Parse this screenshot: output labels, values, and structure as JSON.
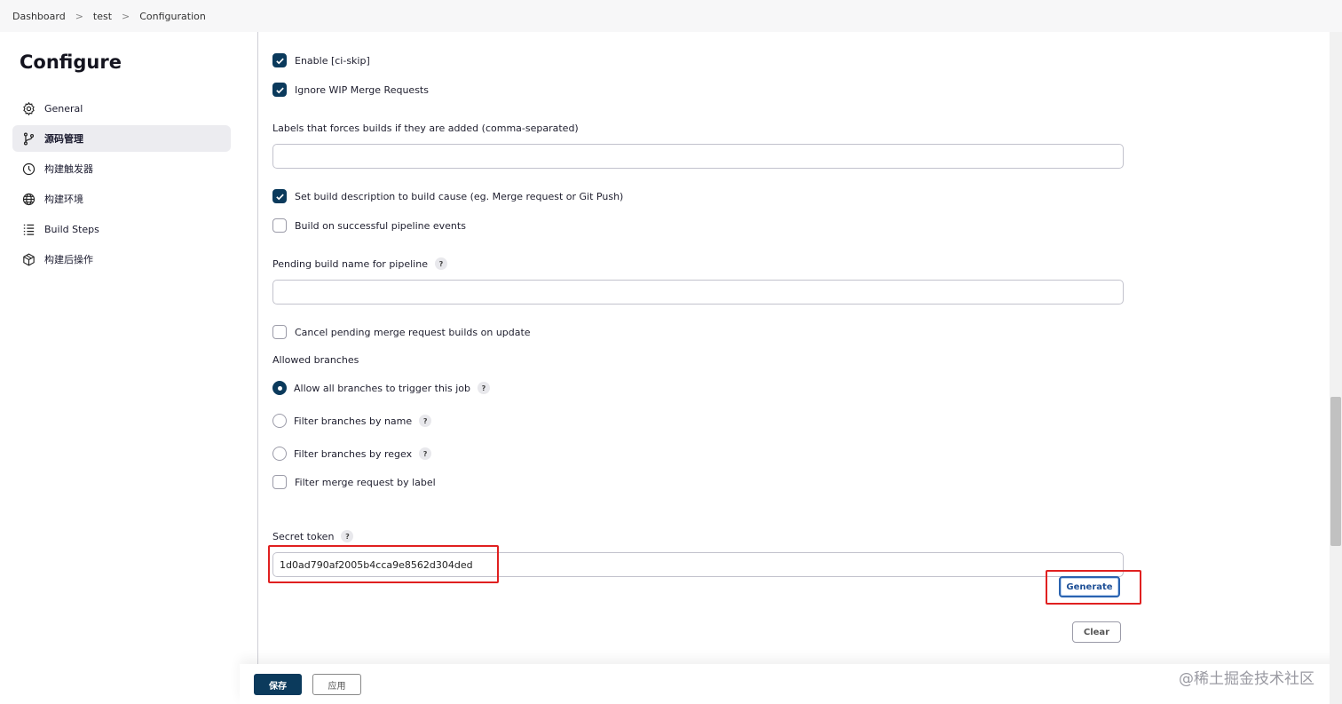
{
  "breadcrumb": {
    "items": [
      "Dashboard",
      "test",
      "Configuration"
    ]
  },
  "sidebar": {
    "title": "Configure",
    "items": [
      {
        "label": "General",
        "icon": "gear-icon",
        "active": false
      },
      {
        "label": "源码管理",
        "icon": "branch-icon",
        "active": true
      },
      {
        "label": "构建触发器",
        "icon": "clock-icon",
        "active": false
      },
      {
        "label": "构建环境",
        "icon": "globe-icon",
        "active": false
      },
      {
        "label": "Build Steps",
        "icon": "list-icon",
        "active": false
      },
      {
        "label": "构建后操作",
        "icon": "box-icon",
        "active": false
      }
    ]
  },
  "form": {
    "enable_ci_skip": {
      "label": "Enable [ci-skip]",
      "checked": true
    },
    "ignore_wip": {
      "label": "Ignore WIP Merge Requests",
      "checked": true
    },
    "labels_force": {
      "label": "Labels that forces builds if they are added (comma-separated)",
      "value": ""
    },
    "set_build_desc": {
      "label": "Set build description to build cause (eg. Merge request or Git Push)",
      "checked": true
    },
    "build_on_pipeline": {
      "label": "Build on successful pipeline events",
      "checked": false
    },
    "pending_build_name": {
      "label": "Pending build name for pipeline",
      "value": ""
    },
    "cancel_pending": {
      "label": "Cancel pending merge request builds on update",
      "checked": false
    },
    "allowed_branches": {
      "label": "Allowed branches",
      "options": [
        {
          "label": "Allow all branches to trigger this job",
          "selected": true,
          "help": true
        },
        {
          "label": "Filter branches by name",
          "selected": false,
          "help": true
        },
        {
          "label": "Filter branches by regex",
          "selected": false,
          "help": true
        }
      ]
    },
    "filter_mr_label": {
      "label": "Filter merge request by label",
      "checked": false
    },
    "secret_token": {
      "label": "Secret token",
      "value": "1d0ad790af2005b4cca9e8562d304ded"
    },
    "generate_label": "Generate",
    "clear_label": "Clear",
    "help_glyph": "?"
  },
  "footer": {
    "save_label": "保存",
    "apply_label": "应用"
  },
  "watermark": "@稀土掘金技术社区",
  "colors": {
    "accent": "#0b3a5c",
    "highlight": "#e02020",
    "generate_border": "#2a63b0"
  }
}
